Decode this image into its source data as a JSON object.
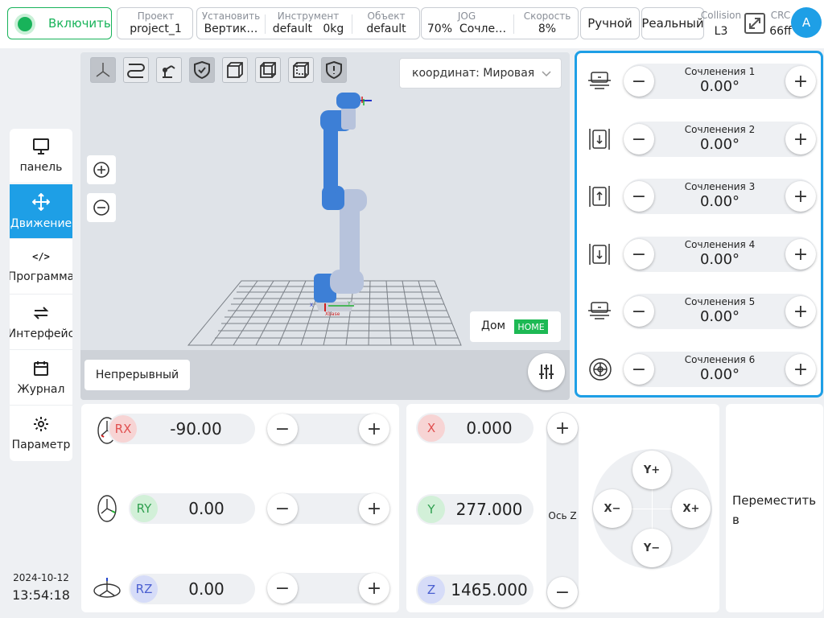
{
  "header": {
    "power_label": "Включить",
    "project": {
      "label": "Проект",
      "value": "project_1"
    },
    "install": {
      "label": "Установить",
      "value": "Вертик…"
    },
    "tool": {
      "label": "Инструмент",
      "name": "default",
      "weight": "0kg"
    },
    "object": {
      "label": "Объект",
      "value": "default"
    },
    "jog": {
      "label": "JOG",
      "percent": "70%",
      "mode": "Сочле…"
    },
    "speed": {
      "label": "Скорость",
      "value": "8%"
    },
    "manual_label": "Ручной",
    "real_label": "Реальный",
    "collision": {
      "label": "Collision",
      "value": "L3"
    },
    "crc": {
      "label": "CRC",
      "value": "66ff"
    },
    "avatar": "A"
  },
  "sidebar": {
    "items": [
      {
        "label": "панель",
        "icon": "monitor-icon"
      },
      {
        "label": "Движение",
        "icon": "move-arrows-icon"
      },
      {
        "label": "Программа",
        "icon": "code-icon"
      },
      {
        "label": "Интерфейс",
        "icon": "swap-icon"
      },
      {
        "label": "Журнал",
        "icon": "calendar-icon"
      },
      {
        "label": "Параметр",
        "icon": "gear-icon"
      }
    ],
    "active": "Движение",
    "date": "2024-10-12",
    "time": "13:54:18"
  },
  "viewport": {
    "coord_label": "координат: Мировая",
    "home_label": "Дом",
    "home_badge": "HOME",
    "continuous_label": "Непрерывный",
    "axis_labels": {
      "x": "X",
      "y": "Y",
      "base": "Xbase"
    }
  },
  "joints": [
    {
      "name": "Сочленения 1",
      "value": "0.00°"
    },
    {
      "name": "Сочленения 2",
      "value": "0.00°"
    },
    {
      "name": "Сочленения 3",
      "value": "0.00°"
    },
    {
      "name": "Сочленения 4",
      "value": "0.00°"
    },
    {
      "name": "Сочленения 5",
      "value": "0.00°"
    },
    {
      "name": "Сочленения 6",
      "value": "0.00°"
    }
  ],
  "rotation": [
    {
      "axis": "RX",
      "value": "-90.00"
    },
    {
      "axis": "RY",
      "value": "0.00"
    },
    {
      "axis": "RZ",
      "value": "0.00"
    }
  ],
  "position": [
    {
      "axis": "X",
      "value": "0.000"
    },
    {
      "axis": "Y",
      "value": "277.000"
    },
    {
      "axis": "Z",
      "value": "1465.000"
    }
  ],
  "z_axis_label": "Ось Z",
  "dpad": {
    "up": "Y+",
    "down": "Y−",
    "left": "X−",
    "right": "X+"
  },
  "move_to_label": "Переместить в",
  "colors": {
    "accent": "#1e9fe6",
    "power_green": "#18b35a",
    "home_green": "#1db954",
    "robot_blue": "#3d7fd6",
    "robot_grey": "#b7c3dc"
  }
}
